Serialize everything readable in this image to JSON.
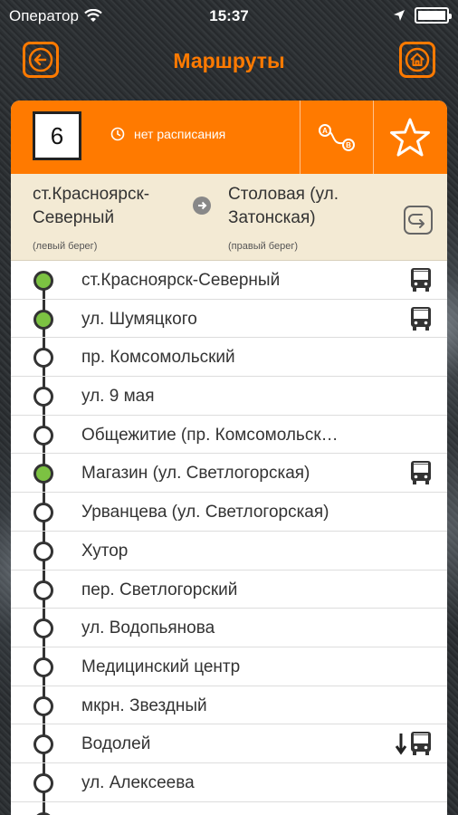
{
  "status_bar": {
    "carrier": "Оператор",
    "time": "15:37"
  },
  "nav": {
    "title": "Маршруты",
    "back_icon": "back-arrow-icon",
    "home_icon": "home-icon"
  },
  "route": {
    "number": "6",
    "schedule": "нет расписания",
    "from": "ст.Красноярск-Северный",
    "from_bank": "(левый берег)",
    "to": "Столовая (ул. Затонская)",
    "to_bank": "(правый берег)"
  },
  "colors": {
    "accent": "#ff7a00",
    "active_stop": "#7cc242",
    "direction_bg": "#f3ead4"
  },
  "stops": [
    {
      "name": "ст.Красноярск-Северный",
      "active": true,
      "icon": "bus"
    },
    {
      "name": "ул. Шумяцкого",
      "active": true,
      "icon": "bus"
    },
    {
      "name": "пр. Комсомольский",
      "active": false,
      "icon": ""
    },
    {
      "name": "ул. 9 мая",
      "active": false,
      "icon": ""
    },
    {
      "name": "Общежитие (пр. Комсомольск…",
      "active": false,
      "icon": ""
    },
    {
      "name": "Магазин (ул. Светлогорская)",
      "active": true,
      "icon": "bus"
    },
    {
      "name": "Урванцева (ул. Светлогорская)",
      "active": false,
      "icon": ""
    },
    {
      "name": "Хутор",
      "active": false,
      "icon": ""
    },
    {
      "name": "пер. Светлогорский",
      "active": false,
      "icon": ""
    },
    {
      "name": "ул. Водопьянова",
      "active": false,
      "icon": ""
    },
    {
      "name": "Медицинский центр",
      "active": false,
      "icon": ""
    },
    {
      "name": "мкрн. Звездный",
      "active": false,
      "icon": ""
    },
    {
      "name": "Водолей",
      "active": false,
      "icon": "arrow-bus"
    },
    {
      "name": "ул. Алексеева",
      "active": false,
      "icon": ""
    },
    {
      "name": "",
      "active": false,
      "icon": ""
    }
  ]
}
